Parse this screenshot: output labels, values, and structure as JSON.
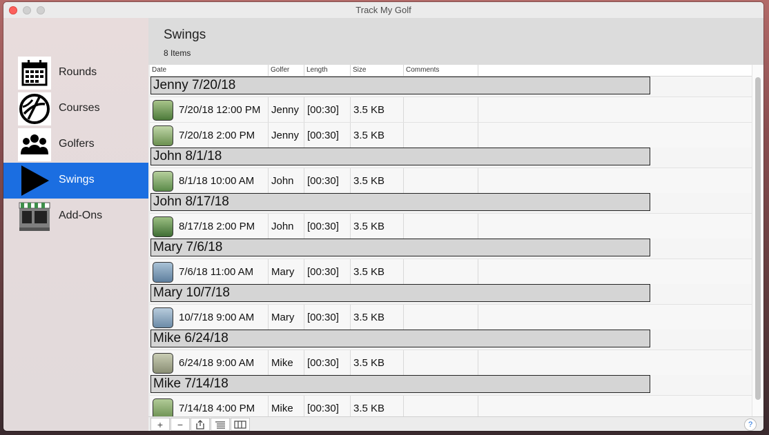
{
  "window": {
    "title": "Track My Golf"
  },
  "sidebar": {
    "items": [
      {
        "label": "Rounds",
        "icon": "calendar-icon",
        "active": false
      },
      {
        "label": "Courses",
        "icon": "globe-icon",
        "active": false
      },
      {
        "label": "Golfers",
        "icon": "people-icon",
        "active": false
      },
      {
        "label": "Swings",
        "icon": "play-icon",
        "active": true
      },
      {
        "label": "Add-Ons",
        "icon": "store-icon",
        "active": false
      }
    ]
  },
  "header": {
    "title": "Swings",
    "count": "8 Items"
  },
  "table": {
    "columns": [
      "Date",
      "Golfer",
      "Length",
      "Size",
      "Comments"
    ],
    "groups": [
      {
        "title": "Jenny 7/20/18",
        "rows": [
          {
            "date": "7/20/18 12:00 PM",
            "golfer": "Jenny",
            "length": "[00:30]",
            "size": "3.5 KB",
            "comments": ""
          },
          {
            "date": "7/20/18 2:00 PM",
            "golfer": "Jenny",
            "length": "[00:30]",
            "size": "3.5 KB",
            "comments": ""
          }
        ]
      },
      {
        "title": "John 8/1/18",
        "rows": [
          {
            "date": "8/1/18 10:00 AM",
            "golfer": "John",
            "length": "[00:30]",
            "size": "3.5 KB",
            "comments": ""
          }
        ]
      },
      {
        "title": "John 8/17/18",
        "rows": [
          {
            "date": "8/17/18 2:00 PM",
            "golfer": "John",
            "length": "[00:30]",
            "size": "3.5 KB",
            "comments": ""
          }
        ]
      },
      {
        "title": "Mary 7/6/18",
        "rows": [
          {
            "date": "7/6/18 11:00 AM",
            "golfer": "Mary",
            "length": "[00:30]",
            "size": "3.5 KB",
            "comments": ""
          }
        ]
      },
      {
        "title": "Mary 10/7/18",
        "rows": [
          {
            "date": "10/7/18 9:00 AM",
            "golfer": "Mary",
            "length": "[00:30]",
            "size": "3.5 KB",
            "comments": ""
          }
        ]
      },
      {
        "title": "Mike 6/24/18",
        "rows": [
          {
            "date": "6/24/18 9:00 AM",
            "golfer": "Mike",
            "length": "[00:30]",
            "size": "3.5 KB",
            "comments": ""
          }
        ]
      },
      {
        "title": "Mike 7/14/18",
        "rows": [
          {
            "date": "7/14/18 4:00 PM",
            "golfer": "Mike",
            "length": "[00:30]",
            "size": "3.5 KB",
            "comments": ""
          }
        ]
      }
    ]
  },
  "toolbar": {
    "add_label": "+",
    "remove_label": "−",
    "share_icon": "share-icon",
    "list_icon": "list-icon",
    "columns_icon": "columns-icon",
    "help_label": "?"
  },
  "colors": {
    "accent": "#1b6ee1",
    "group_bg": "#d5d5d5"
  }
}
